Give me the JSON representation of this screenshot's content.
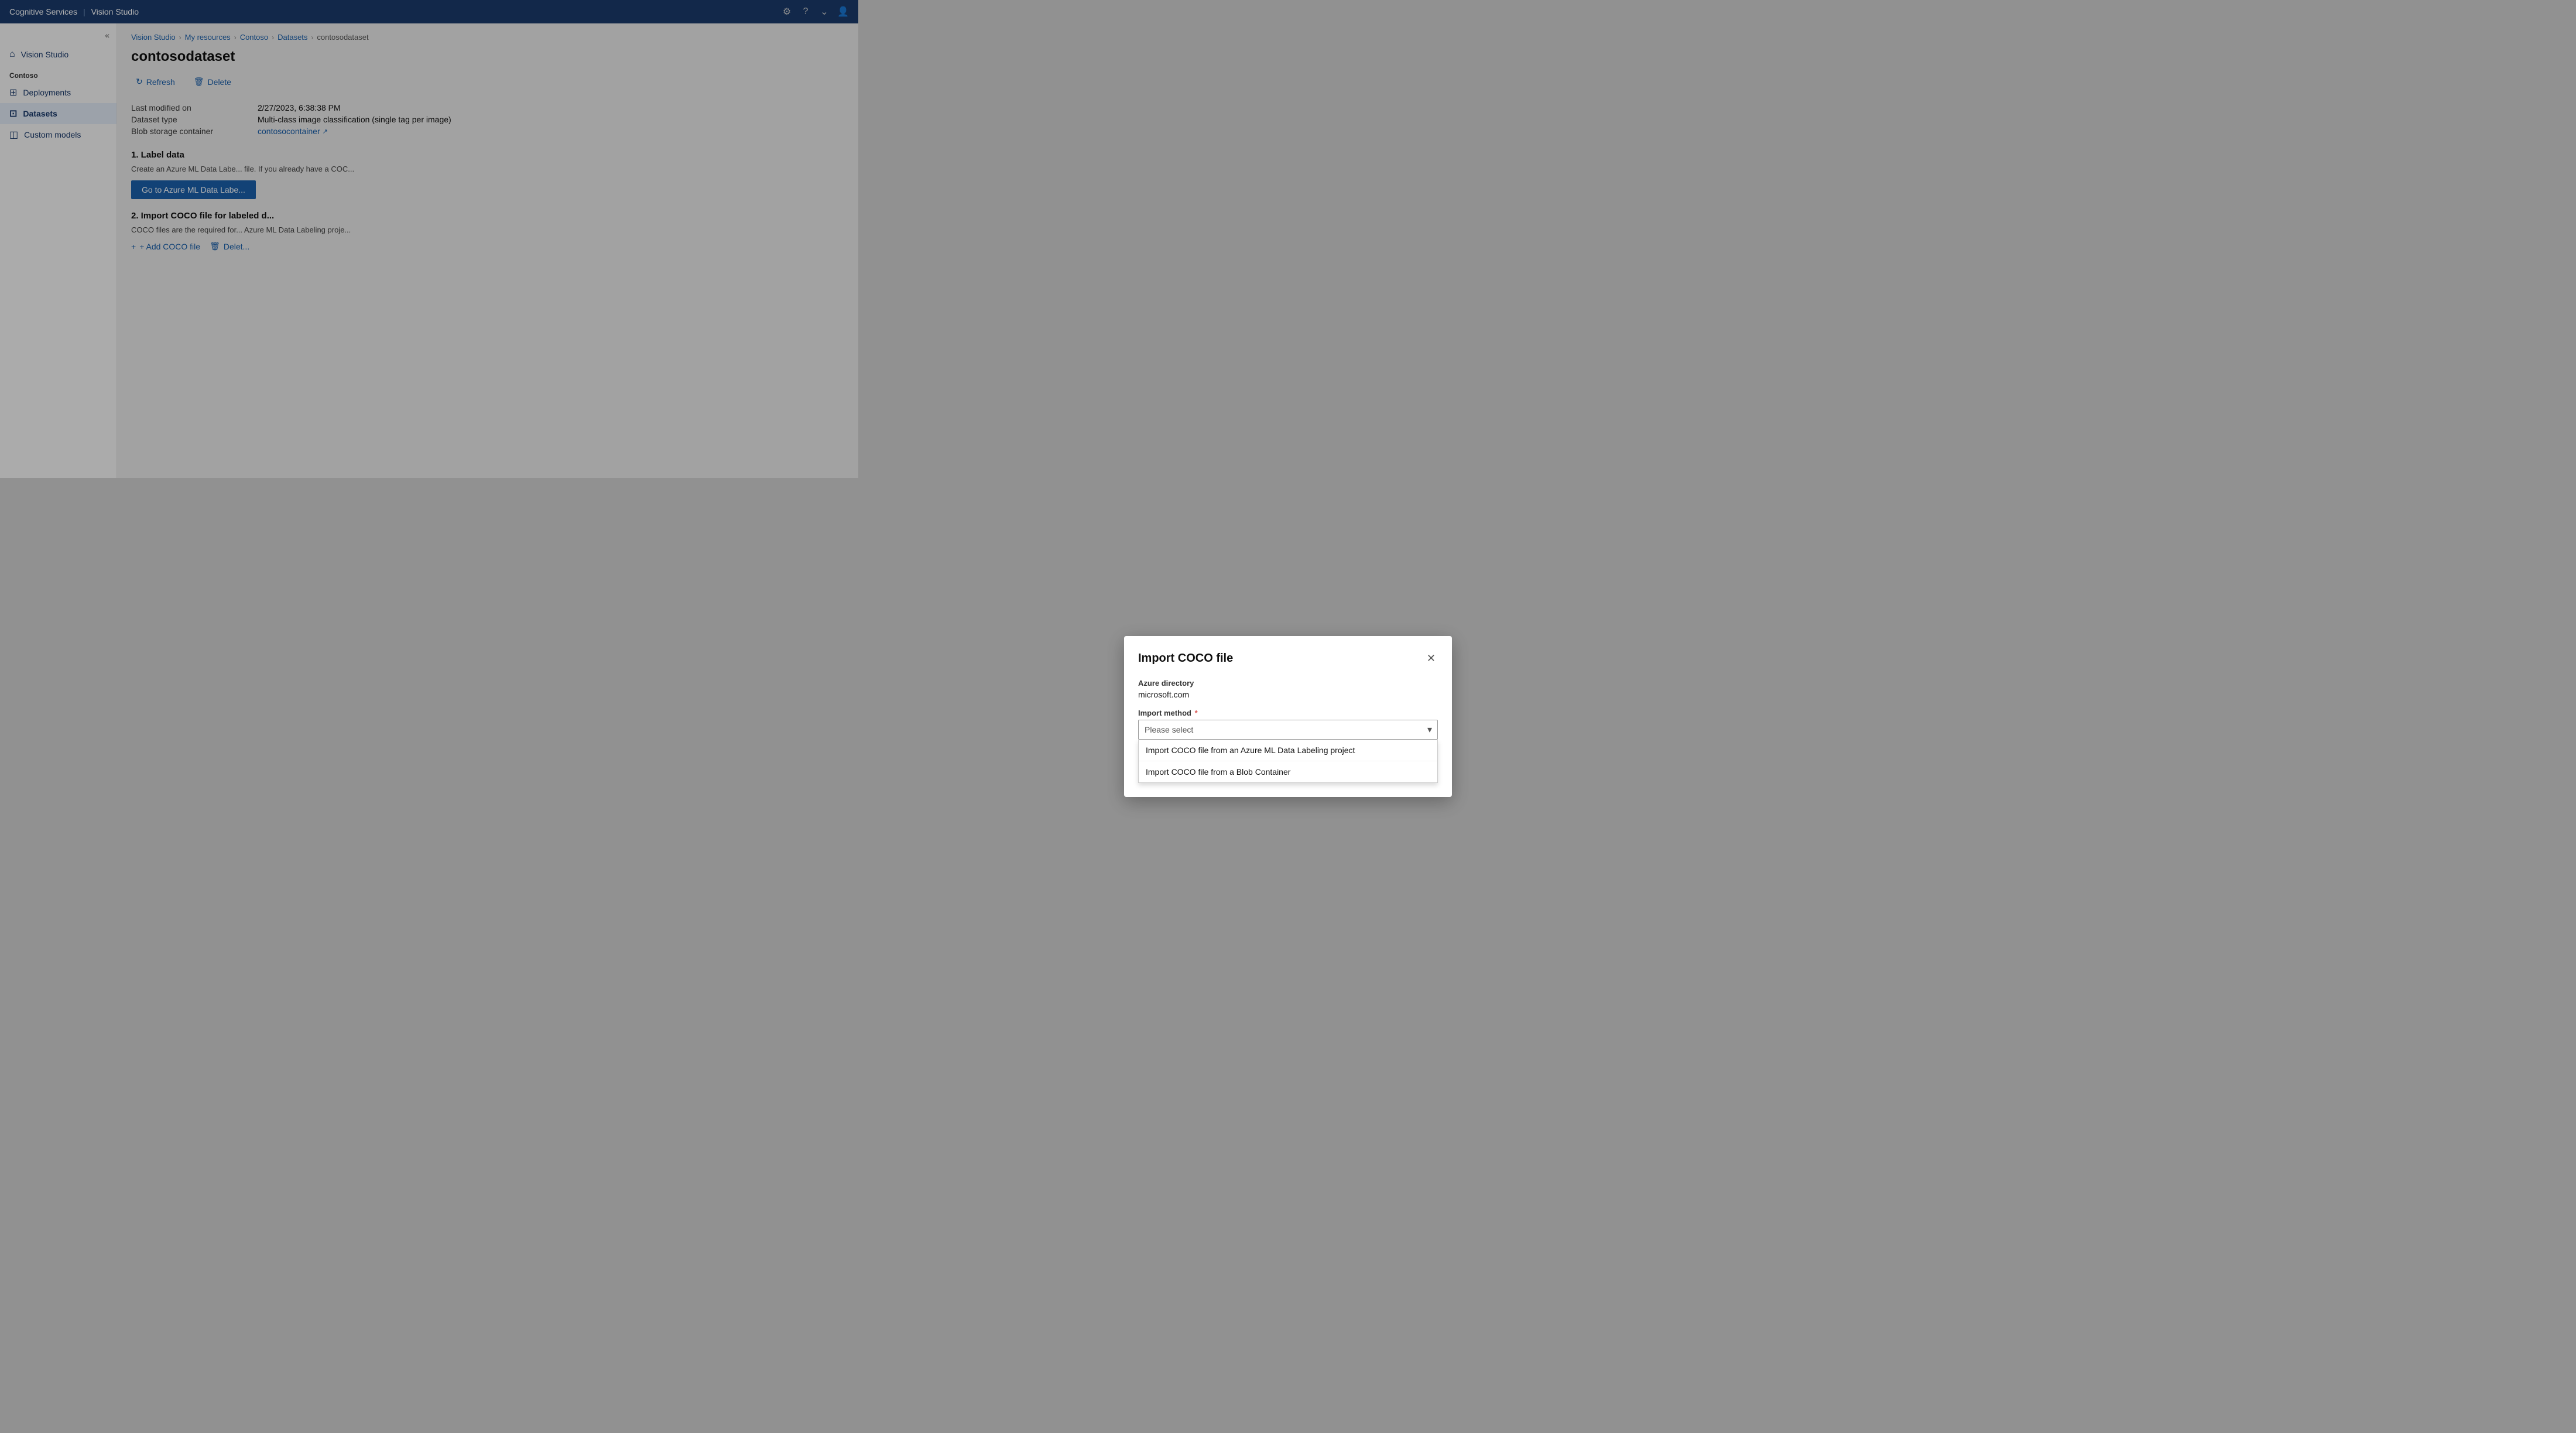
{
  "app": {
    "title": "Cognitive Services",
    "subtitle": "Vision Studio"
  },
  "topbar": {
    "title_left": "Cognitive Services | Vision Studio",
    "icons": [
      "gear-icon",
      "question-icon",
      "chevron-down-icon",
      "user-icon"
    ]
  },
  "sidebar": {
    "collapse_icon": "«",
    "nav_home": "Vision Studio",
    "section_label": "Contoso",
    "items": [
      {
        "id": "deployments",
        "label": "Deployments",
        "icon": "⊞"
      },
      {
        "id": "datasets",
        "label": "Datasets",
        "icon": "⊡",
        "active": true
      },
      {
        "id": "custom-models",
        "label": "Custom models",
        "icon": "◫"
      }
    ]
  },
  "breadcrumb": {
    "items": [
      {
        "label": "Vision Studio",
        "id": "vision-studio"
      },
      {
        "label": "My resources",
        "id": "my-resources"
      },
      {
        "label": "Contoso",
        "id": "contoso"
      },
      {
        "label": "Datasets",
        "id": "datasets"
      },
      {
        "label": "contosodataset",
        "id": "contosodataset",
        "current": true
      }
    ],
    "separator": "›"
  },
  "page": {
    "title": "contosodataset"
  },
  "toolbar": {
    "refresh_label": "Refresh",
    "delete_label": "Delete"
  },
  "dataset_info": {
    "last_modified_label": "Last modified on",
    "last_modified_value": "2/27/2023, 6:38:38 PM",
    "dataset_type_label": "Dataset type",
    "dataset_type_value": "Multi-class image classification (single tag per image)",
    "blob_storage_label": "Blob storage container",
    "blob_storage_link": "contosocontainer"
  },
  "section1": {
    "title": "1. Label data",
    "description": "Create an Azure ML Data Labe... file. If you already have a COC...",
    "btn_label": "Go to Azure ML Data Labe..."
  },
  "section2": {
    "title": "2. Import COCO file for labeled d...",
    "description": "COCO files are the required for... Azure ML Data Labeling proje...",
    "add_btn": "+ Add COCO file",
    "delete_btn": "Delet..."
  },
  "dialog": {
    "title": "Import COCO file",
    "azure_directory_label": "Azure directory",
    "azure_directory_value": "microsoft.com",
    "import_method_label": "Import method",
    "required": true,
    "select_placeholder": "Please select",
    "options": [
      {
        "id": "azure-ml",
        "label": "Import COCO file from an Azure ML Data Labeling project"
      },
      {
        "id": "blob",
        "label": "Import COCO file from a Blob Container"
      }
    ]
  }
}
